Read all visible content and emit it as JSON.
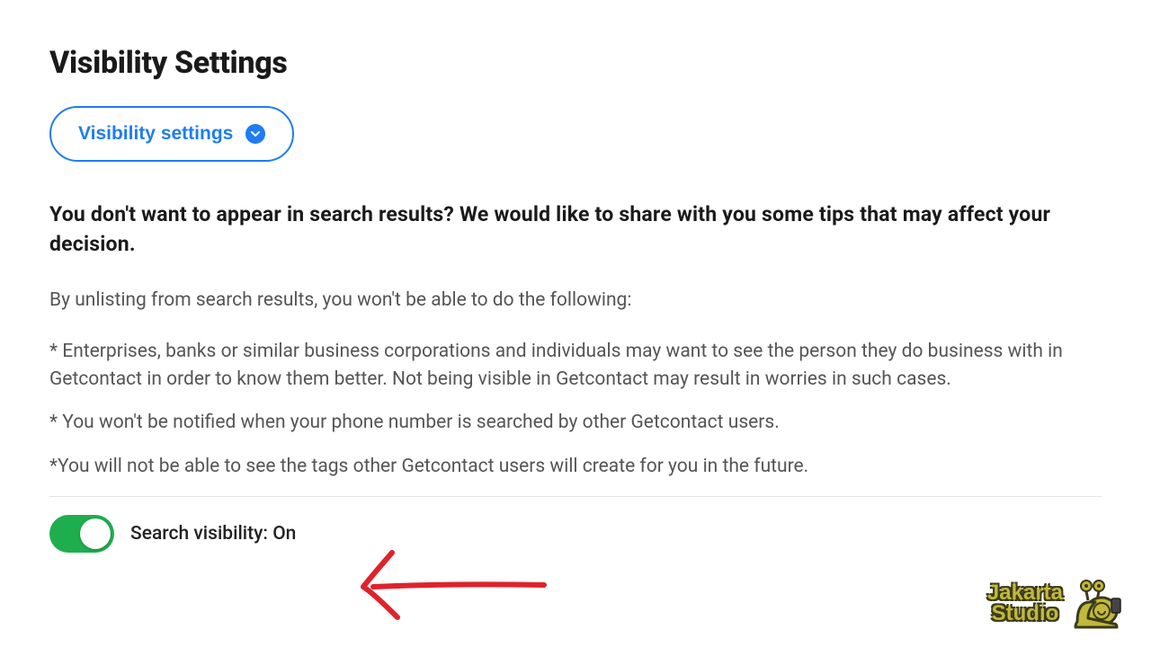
{
  "title": "Visibility Settings",
  "dropdown": {
    "label": "Visibility settings"
  },
  "prompt": "You don't want to appear in search results? We would like to share with you some tips that may affect your decision.",
  "intro": "By unlisting from search results, you won't be able to do the following:",
  "bullets": [
    "* Enterprises, banks or similar business corporations and individuals may want to see the person they do business with in Getcontact in order to know them better. Not being visible in Getcontact may result in worries in such cases.",
    "* You won't be notified when your phone number is searched by other Getcontact users.",
    "*You will not be able to see the tags other Getcontact users will create for you in the future."
  ],
  "toggle": {
    "label_prefix": "Search visibility: ",
    "status": "On",
    "on": true
  },
  "watermark": {
    "line1": "Jakarta",
    "line2": "Studio"
  }
}
